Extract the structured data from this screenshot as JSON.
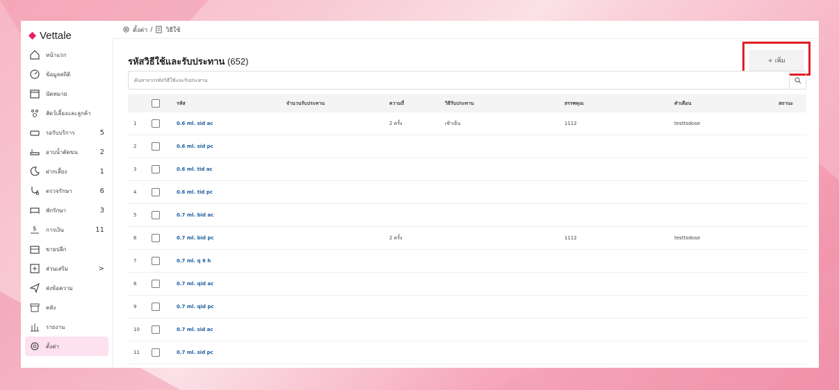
{
  "app": {
    "brand": "Vettale",
    "brand_color": "#e91e63"
  },
  "breadcrumb": {
    "parent": "ตั้งค่า",
    "separator": "/",
    "current": "วิธีใช้"
  },
  "sidebar": {
    "items": [
      {
        "label": "หน้าแรก",
        "icon": "home-icon",
        "badge": ""
      },
      {
        "label": "ข้อมูลสถิติ",
        "icon": "dashboard-icon",
        "badge": ""
      },
      {
        "label": "นัดหมาย",
        "icon": "calendar-icon",
        "badge": ""
      },
      {
        "label": "สัตว์เลี้ยงและลูกค้า",
        "icon": "paw-icon",
        "badge": ""
      },
      {
        "label": "รอรับบริการ",
        "icon": "sofa-icon",
        "badge": "5"
      },
      {
        "label": "อาบน้ำตัดขน",
        "icon": "bathtub-icon",
        "badge": "2"
      },
      {
        "label": "ฝากเลี้ยง",
        "icon": "moon-icon",
        "badge": "1"
      },
      {
        "label": "ตรวจรักษา",
        "icon": "stethoscope-icon",
        "badge": "6"
      },
      {
        "label": "พักรักษา",
        "icon": "bed-icon",
        "badge": "3"
      },
      {
        "label": "การเงิน",
        "icon": "money-icon",
        "badge": "11"
      },
      {
        "label": "ขายปลีก",
        "icon": "cash-register-icon",
        "badge": ""
      },
      {
        "label": "ส่วนเสริม",
        "icon": "plus-square-icon",
        "badge": ">"
      },
      {
        "label": "ส่งข้อความ",
        "icon": "send-icon",
        "badge": ""
      },
      {
        "label": "คลัง",
        "icon": "archive-icon",
        "badge": ""
      },
      {
        "label": "รายงาน",
        "icon": "bar-chart-icon",
        "badge": ""
      },
      {
        "label": "ตั้งค่า",
        "icon": "settings-icon",
        "badge": "",
        "active": true
      }
    ]
  },
  "page": {
    "title": "รหัสวิธีใช้และรับประทาน",
    "count": "(652)",
    "add_label": "+ เพิ่ม",
    "search_placeholder": "ค้นหาจากรหัสวิธีใช้และรับประทาน"
  },
  "table": {
    "headers": {
      "code": "รหัส",
      "qty": "จำนวนรับประทาน",
      "times": "ความถี่",
      "method": "วิธีรับประทาน",
      "property": "สรรพคุณ",
      "warning": "คำเตือน",
      "status": "สถานะ"
    },
    "rows": [
      {
        "no": "1",
        "code": "0.6 ml. sid ac",
        "times": "2 ครั้ง",
        "method": "เช้าเย็น",
        "property": "1112",
        "warning": "testtodose"
      },
      {
        "no": "2",
        "code": "0.6 ml. sid pc",
        "times": "",
        "method": "",
        "property": "",
        "warning": ""
      },
      {
        "no": "3",
        "code": "0.6 ml. tid ac",
        "times": "",
        "method": "",
        "property": "",
        "warning": ""
      },
      {
        "no": "4",
        "code": "0.6 ml. tid pc",
        "times": "",
        "method": "",
        "property": "",
        "warning": ""
      },
      {
        "no": "5",
        "code": "0.7 ml. bid ac",
        "times": "",
        "method": "",
        "property": "",
        "warning": ""
      },
      {
        "no": "6",
        "code": "0.7 ml. bid pc",
        "times": "2 ครั้ง",
        "method": "",
        "property": "1112",
        "warning": "testtodose"
      },
      {
        "no": "7",
        "code": "0.7 ml. q 6 h",
        "times": "",
        "method": "",
        "property": "",
        "warning": ""
      },
      {
        "no": "8",
        "code": "0.7 ml. qid ac",
        "times": "",
        "method": "",
        "property": "",
        "warning": ""
      },
      {
        "no": "9",
        "code": "0.7 ml. qid pc",
        "times": "",
        "method": "",
        "property": "",
        "warning": ""
      },
      {
        "no": "10",
        "code": "0.7 ml. sid ac",
        "times": "",
        "method": "",
        "property": "",
        "warning": ""
      },
      {
        "no": "11",
        "code": "0.7 ml. sid pc",
        "times": "",
        "method": "",
        "property": "",
        "warning": ""
      }
    ]
  }
}
